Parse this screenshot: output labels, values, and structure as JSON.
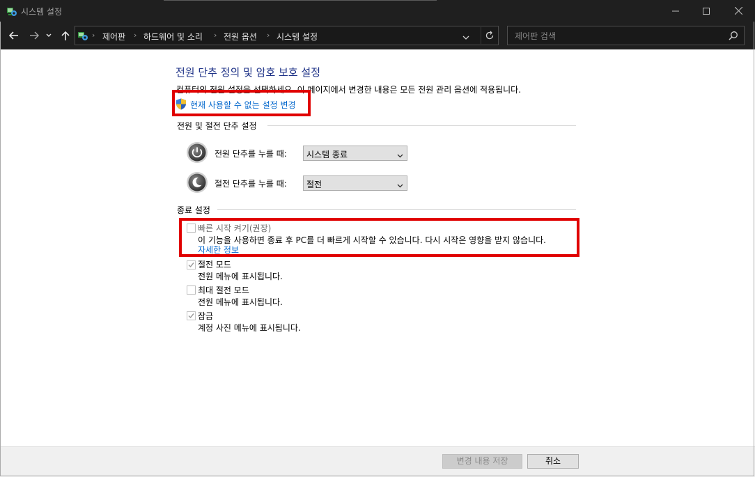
{
  "window": {
    "title": "시스템 설정"
  },
  "address": {
    "crumbs": [
      "제어판",
      "하드웨어 및 소리",
      "전원 옵션",
      "시스템 설정"
    ]
  },
  "search": {
    "placeholder": "제어판 검색"
  },
  "page": {
    "title": "전원 단추 정의 및 암호 보호 설정",
    "description": "컴퓨터의 전원 설정을 선택하세요. 이 페이지에서 변경한 내용은 모든 전원 관리 옵션에 적용됩니다.",
    "admin_link": "현재 사용할 수 없는 설정 변경"
  },
  "power_section": {
    "heading": "전원 및 절전 단추 설정",
    "rows": [
      {
        "label": "전원 단추를 누를 때:",
        "value": "시스템 종료"
      },
      {
        "label": "절전 단추를 누를 때:",
        "value": "절전"
      }
    ]
  },
  "shutdown_section": {
    "heading": "종료 설정",
    "options": [
      {
        "label": "빠른 시작 켜기(권장)",
        "checked": false,
        "description": "이 기능을 사용하면 종료 후 PC를 더 빠르게 시작할 수 있습니다. 다시 시작은 영향을 받지 않습니다.",
        "link": "자세한 정보"
      },
      {
        "label": "절전 모드",
        "checked": true,
        "description": "전원 메뉴에 표시됩니다."
      },
      {
        "label": "최대 절전 모드",
        "checked": false,
        "description": "전원 메뉴에 표시됩니다."
      },
      {
        "label": "잠금",
        "checked": true,
        "description": "계정 사진 메뉴에 표시됩니다."
      }
    ]
  },
  "footer": {
    "save_label": "변경 내용 저장",
    "cancel_label": "취소"
  },
  "colors": {
    "title_blue": "#1e3287",
    "link_blue": "#0066cc",
    "highlight_red": "#e00000",
    "titlebar_bg": "#1f1f1f"
  }
}
